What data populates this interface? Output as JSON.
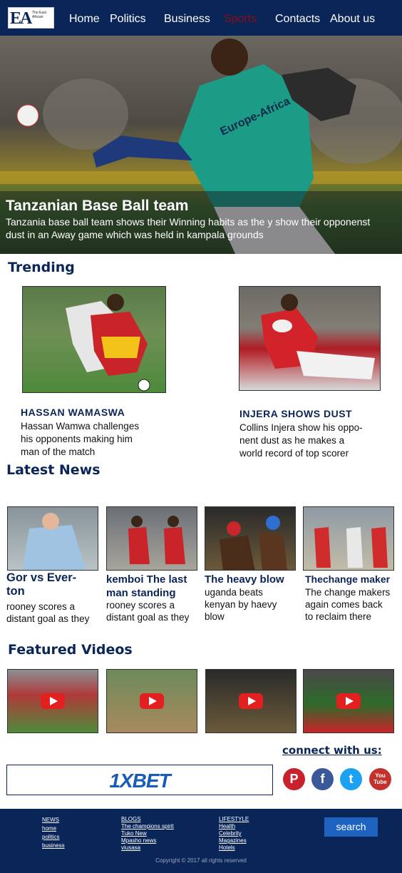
{
  "header": {
    "logo": {
      "letters": "EA",
      "text": "The East African"
    },
    "nav": [
      {
        "label": "Home",
        "active": false
      },
      {
        "label": "Politics",
        "active": false
      },
      {
        "label": "Business",
        "active": false
      },
      {
        "label": "Sports",
        "active": true
      },
      {
        "label": "Contacts",
        "active": false
      },
      {
        "label": "About us",
        "active": false
      }
    ]
  },
  "hero": {
    "title": "Tanzanian Base Ball team",
    "text": "Tanzania base ball team shows their Winning habits as the y show their opponenst dust in an Away game which was held in kampala grounds",
    "jersey_text": "Europe-Africa"
  },
  "trending": {
    "title": "Trending",
    "items": [
      {
        "headline": "HASSAN WAMASWA",
        "lines": [
          "Hassan Wamwa challenges",
          "his opponents making him",
          "man of the match"
        ]
      },
      {
        "headline": "INJERA SHOWS DUST",
        "lines": [
          "Collins Injera show his oppo-",
          "nent dust as he makes a",
          "world record of top scorer"
        ]
      }
    ]
  },
  "latest": {
    "title": "Latest News",
    "items": [
      {
        "headline_lines": [
          "Gor vs Ever-",
          "ton"
        ],
        "body_lines": [
          "rooney scores a",
          "distant goal as they"
        ]
      },
      {
        "headline_lines": [
          "kemboi The last",
          "man standing"
        ],
        "body_lines": [
          "rooney scores a",
          "distant goal as they"
        ]
      },
      {
        "headline_lines": [
          "The heavy blow"
        ],
        "body_lines": [
          "uganda beats",
          "kenyan by haevy",
          "blow"
        ]
      },
      {
        "headline_lines": [
          "Thechange maker"
        ],
        "body_lines": [
          "The change makers",
          "again comes back",
          "to reclaim there"
        ]
      }
    ]
  },
  "videos": {
    "title": "Featured Videos",
    "count": 4
  },
  "connect": {
    "title": "connect with us:",
    "ad": "1XBET",
    "social": [
      {
        "icon": "pinterest-icon",
        "glyph": "P",
        "color": "#c8232c"
      },
      {
        "icon": "facebook-icon",
        "glyph": "f",
        "color": "#3b5998"
      },
      {
        "icon": "twitter-icon",
        "glyph": "t",
        "color": "#1da1f2"
      },
      {
        "icon": "youtube-icon",
        "glyph": "You Tube",
        "color": "#c4302b"
      }
    ]
  },
  "footer": {
    "columns": [
      {
        "heading": "NEWS",
        "links": [
          "home",
          "politics",
          "business"
        ]
      },
      {
        "heading": "BLOGS",
        "links": [
          "The champions spirit",
          "Tuko New",
          "Mpasho news",
          "viusasa"
        ]
      },
      {
        "heading": "LIFESTYLE",
        "links": [
          "Health",
          "Celebrity",
          "Magazines",
          "Hotels"
        ]
      }
    ],
    "search_label": "search",
    "copyright": "Copyright © 2017 all rights reserved"
  },
  "colors": {
    "brand": "#0a2558",
    "active_nav": "#8b0d10",
    "search": "#1e63c0"
  }
}
